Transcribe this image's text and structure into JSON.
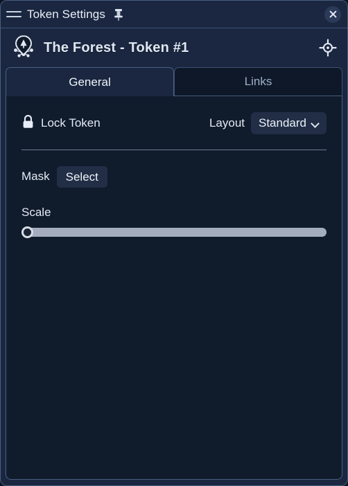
{
  "window": {
    "titlebar": {
      "menu_icon": "hamburger-menu-icon",
      "title": "Token Settings",
      "pin_icon": "pushpin-icon",
      "close_icon": "close-x-icon"
    },
    "token_header": {
      "icon": "map-pin-network-icon",
      "title": "The Forest - Token #1",
      "target_icon": "crosshair-target-icon"
    }
  },
  "tabs": [
    {
      "label": "General",
      "active": true
    },
    {
      "label": "Links",
      "active": false
    }
  ],
  "general": {
    "lock": {
      "icon": "padlock-closed-icon",
      "label": "Lock Token"
    },
    "layout": {
      "label": "Layout",
      "value": "Standard",
      "chevron_icon": "chevron-down-icon"
    },
    "mask": {
      "label": "Mask",
      "button_label": "Select"
    },
    "scale": {
      "label": "Scale",
      "value": 0
    }
  },
  "colors": {
    "window_bg": "#1b2740",
    "panel_bg": "#101b2c",
    "inactive_tab_bg": "#0e1828",
    "border": "#4a5f82",
    "control_bg": "#222e46",
    "text": "#e3eaf4",
    "muted_text": "#9fb0c8",
    "slider_track": "#a4adbe",
    "divider": "#8d9cb4"
  }
}
